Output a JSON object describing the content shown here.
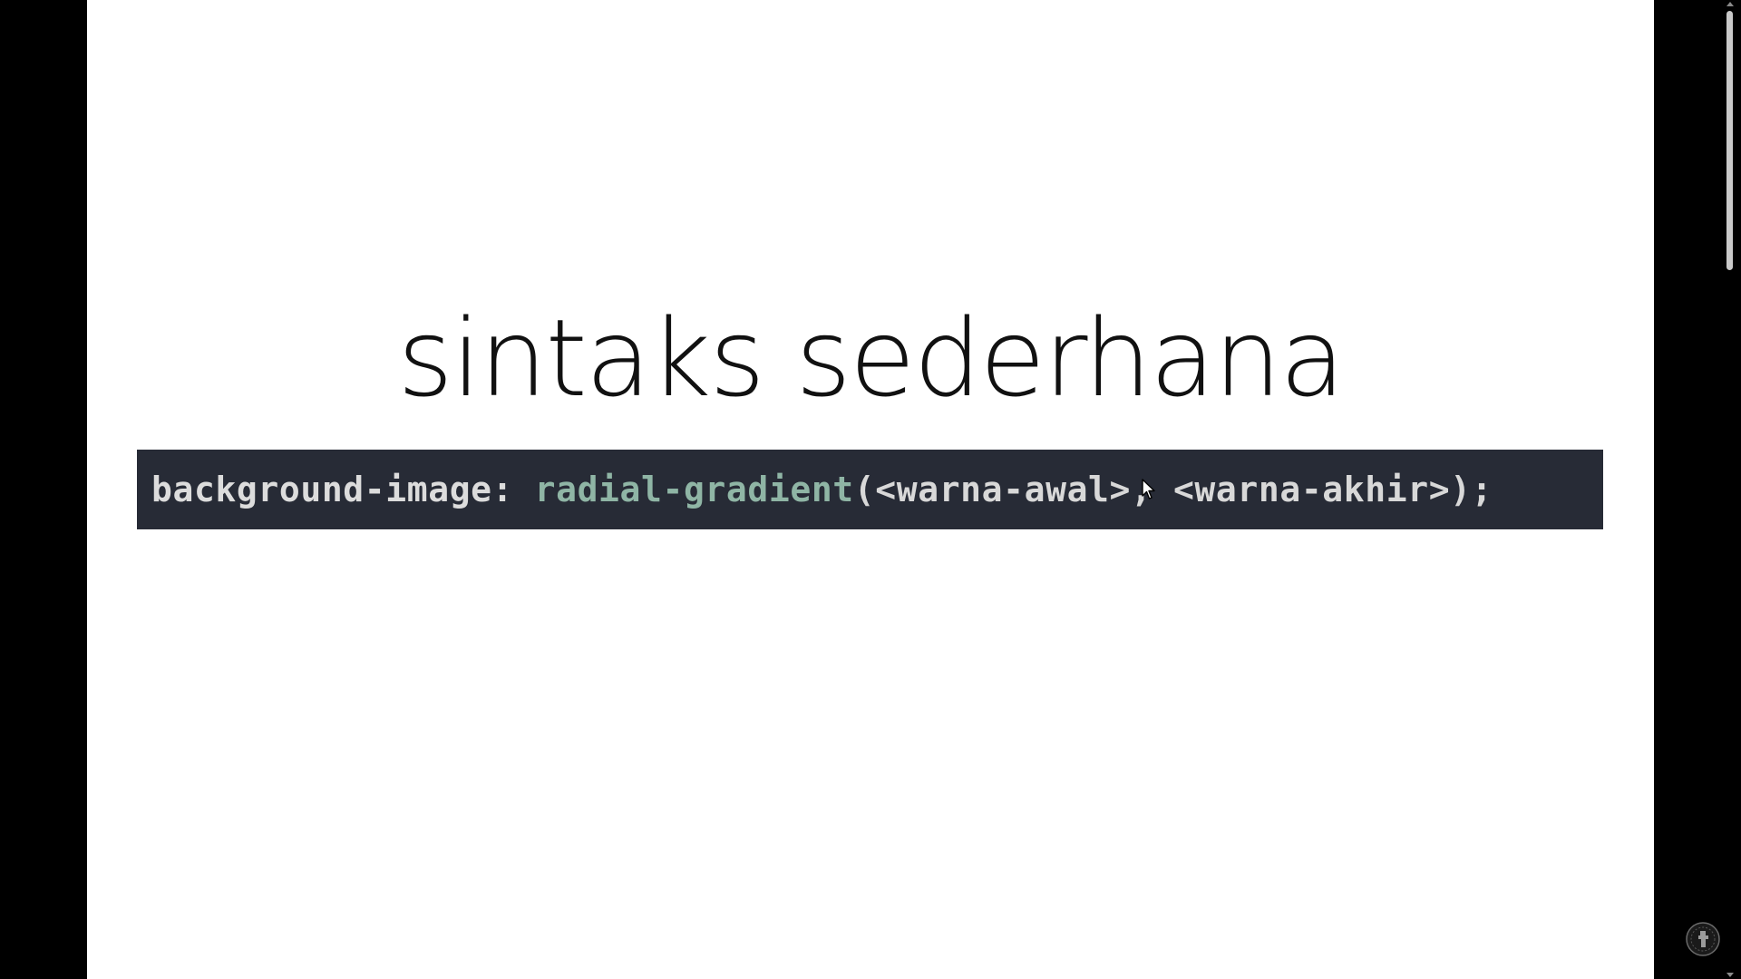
{
  "slide": {
    "title": "sintaks sederhana"
  },
  "code": {
    "property": "background-image:",
    "function": "radial-gradient",
    "open_paren": "(",
    "args": "<warna-awal>, <warna-akhir>",
    "close": ");"
  },
  "colors": {
    "frame": "#000000",
    "slide_background": "#ffffff",
    "code_background": "#272b36",
    "code_property": "#dcdcdc",
    "code_function": "#8fb5a5"
  },
  "icons": {
    "cursor": "mouse-pointer-icon",
    "badge": "watermark-badge-icon",
    "scroll_up": "scroll-up-arrow-icon",
    "scroll_down": "scroll-down-arrow-icon"
  },
  "scroll": {
    "position": 0
  }
}
